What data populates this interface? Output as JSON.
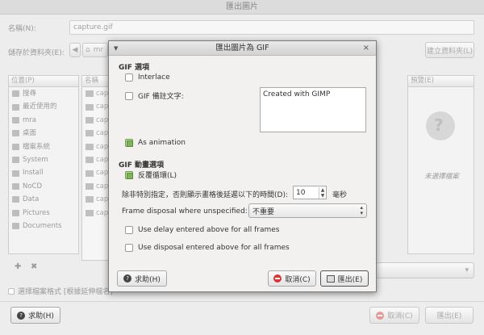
{
  "window": {
    "title": "匯出圖片"
  },
  "form": {
    "name_label": "名稱(N):",
    "name_value": "capture.gif",
    "save_in_label": "儲存於資料夾(E):",
    "path_segment": "mr",
    "create_folder": "建立資料夾(L)"
  },
  "places": {
    "header": "位置(P)",
    "items": [
      "搜尋",
      "最近使用的",
      "mra",
      "桌面",
      "檔案系統",
      "System",
      "Install",
      "NoCD",
      "Data",
      "Pictures",
      "Documents"
    ]
  },
  "files": {
    "header": "名稱",
    "rows": [
      "cap",
      "cap",
      "cap",
      "cap",
      "cap",
      "cap",
      "cap",
      "cap",
      "cap",
      "cap"
    ]
  },
  "preview": {
    "header": "預覽(E)",
    "empty_text": "未選擇檔案"
  },
  "filetype_toggle": "選擇檔案格式 [根據延伸檔名]",
  "main_buttons": {
    "help": "求助(H)",
    "cancel": "取消(C)",
    "export": "匯出(E)"
  },
  "dialog": {
    "title": "匯出圖片為 GIF",
    "gif_options_heading": "GIF 選項",
    "interlace_label": "Interlace",
    "interlace_checked": false,
    "comment_label": "GIF 備註文字:",
    "comment_checked": false,
    "comment_text": "Created with GIMP",
    "as_animation_label": "As animation",
    "as_animation_checked": true,
    "anim_heading": "GIF 動畫選項",
    "loop_label": "反覆循環(L)",
    "loop_checked": true,
    "delay_label": "除非特別指定，否則顯示畫格後延遲以下的時間(D):",
    "delay_value": "10",
    "delay_unit": "毫秒",
    "disposal_label": "Frame disposal where unspecified:",
    "disposal_value": "不重要",
    "use_delay_label": "Use delay entered above for all frames",
    "use_delay_checked": false,
    "use_disposal_label": "Use disposal entered above for all frames",
    "use_disposal_checked": false,
    "help_button": "求助(H)",
    "cancel_button": "取消(C)",
    "export_button": "匯出(E)"
  }
}
